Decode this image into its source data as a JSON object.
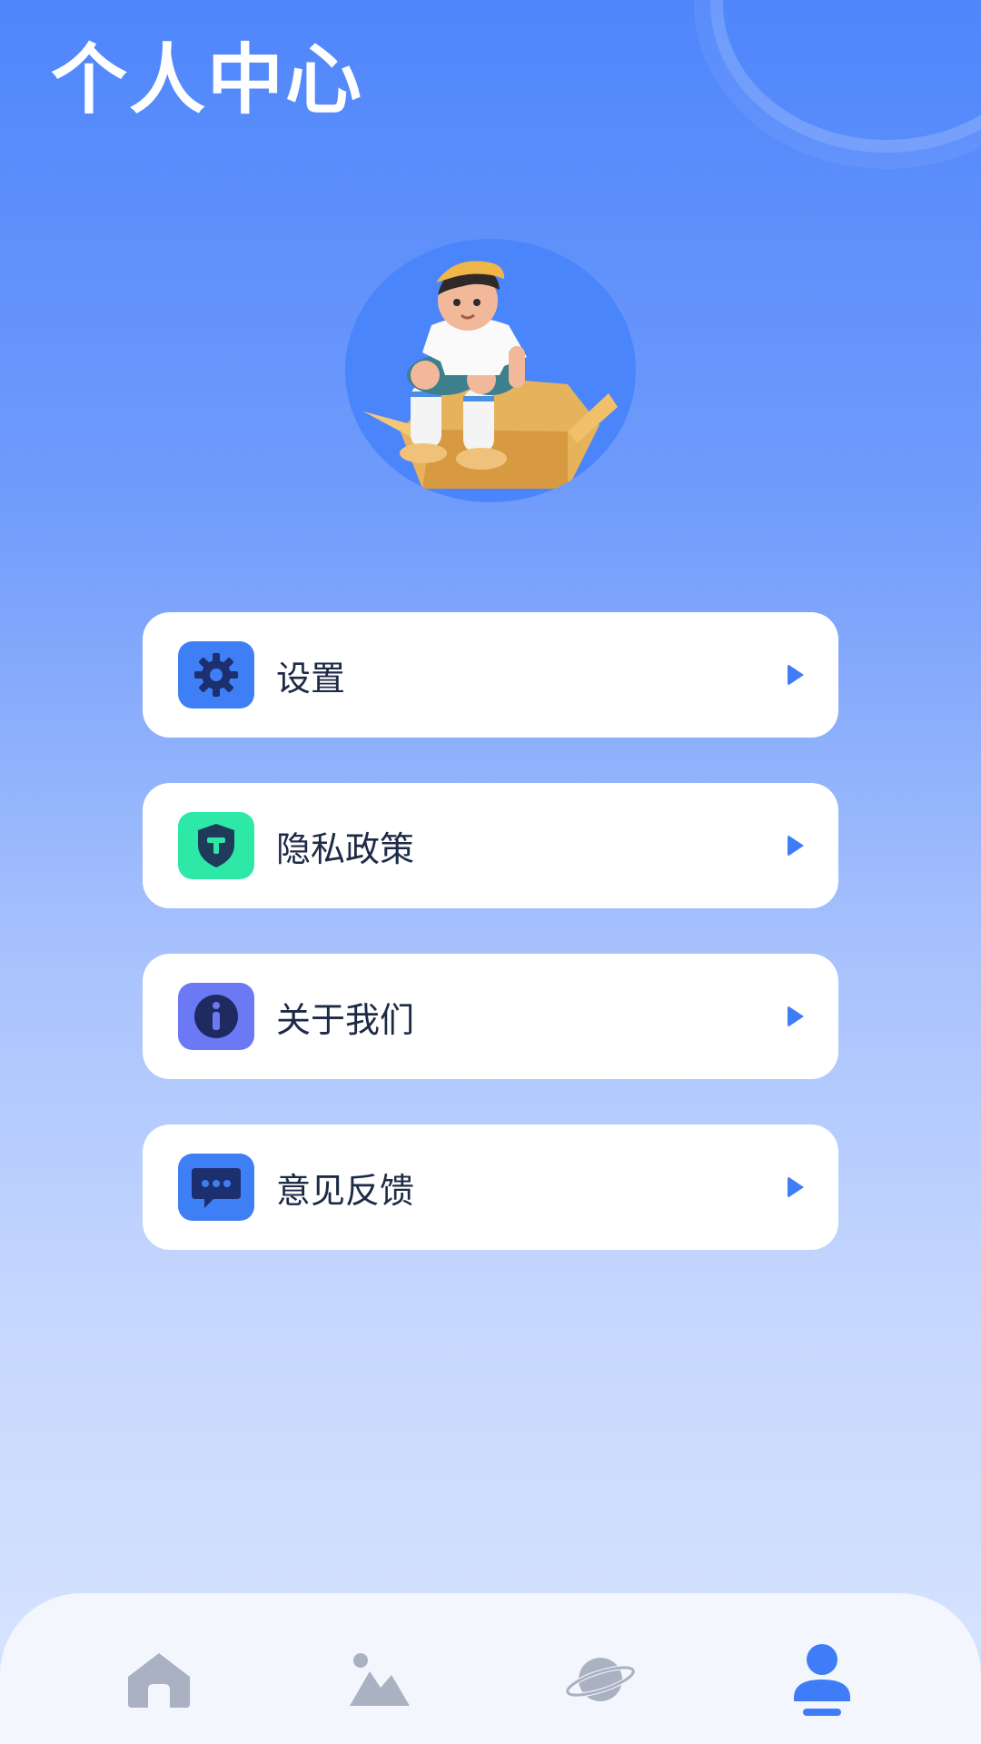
{
  "header": {
    "title": "个人中心"
  },
  "profile": {
    "avatar_icon": "boy-in-box-avatar"
  },
  "menu": {
    "items": [
      {
        "label": "设置",
        "icon": "gear-icon",
        "icon_bg": "#3f7ff5",
        "icon_fg": "#1c2f6e"
      },
      {
        "label": "隐私政策",
        "icon": "shield-icon",
        "icon_bg": "#2ee8a7",
        "icon_fg": "#1f3a5a"
      },
      {
        "label": "关于我们",
        "icon": "info-icon",
        "icon_bg": "#6b79f5",
        "icon_fg": "#1f2a60"
      },
      {
        "label": "意见反馈",
        "icon": "chat-bubble-icon",
        "icon_bg": "#3f7ff5",
        "icon_fg": "#1c2f6e"
      }
    ]
  },
  "tabbar": {
    "tabs": [
      {
        "icon": "home-icon",
        "active": false
      },
      {
        "icon": "picture-icon",
        "active": false
      },
      {
        "icon": "planet-icon",
        "active": false
      },
      {
        "icon": "user-icon",
        "active": true
      }
    ],
    "active_color": "#3f7cf8",
    "inactive_color": "#a9b1c2"
  },
  "colors": {
    "accent": "#3f7cf8",
    "background_top": "#4f86fb",
    "background_bottom": "#d9e5ff"
  }
}
